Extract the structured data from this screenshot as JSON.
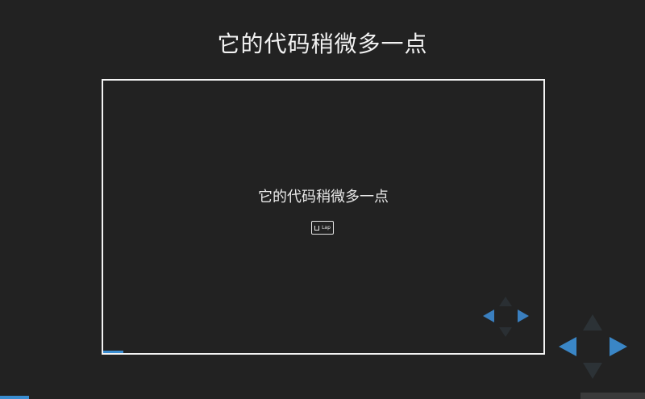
{
  "slide": {
    "title": "它的代码稍微多一点"
  },
  "embedded_presentation": {
    "title": "它的代码稍微多一点",
    "badge_icon": "presentation-badge-icon",
    "badge_text": "Lap",
    "progress_fraction": 0.045
  },
  "controls": {
    "embedded": {
      "left_icon": "arrow-left-icon",
      "right_icon": "arrow-right-icon",
      "up_icon": "arrow-up-icon",
      "down_icon": "arrow-down-icon"
    },
    "outer": {
      "left_icon": "arrow-left-icon",
      "right_icon": "arrow-right-icon",
      "up_icon": "arrow-up-icon",
      "down_icon": "arrow-down-icon"
    }
  },
  "progress": {
    "fraction": 0.045
  },
  "colors": {
    "background": "#222222",
    "accent": "#3a8dd1",
    "text": "#f2f2f2"
  }
}
